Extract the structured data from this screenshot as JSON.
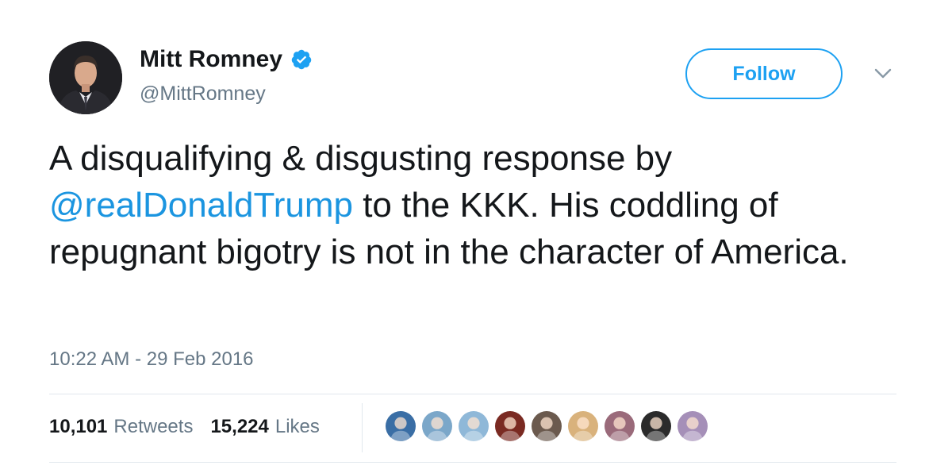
{
  "author": {
    "display_name": "Mitt Romney",
    "handle": "@MittRomney",
    "verified": true
  },
  "follow_label": "Follow",
  "tweet": {
    "text_before": "A disqualifying & disgusting response by ",
    "mention": "@realDonaldTrump",
    "text_after": " to the KKK. His coddling of repugnant bigotry is not in the character of America.",
    "timestamp": "10:22 AM - 29 Feb 2016"
  },
  "stats": {
    "retweets_count": "10,101",
    "retweets_label": "Retweets",
    "likes_count": "15,224",
    "likes_label": "Likes"
  },
  "colors": {
    "accent": "#1da1f2",
    "mention": "#1b95e0",
    "secondary_text": "#657786",
    "divider": "#e1e8ed"
  },
  "likers": [
    {
      "icon": "liker-avatar-icon",
      "color": "#3a6ea5"
    },
    {
      "icon": "liker-avatar-icon",
      "color": "#7ba7c9"
    },
    {
      "icon": "liker-avatar-icon",
      "color": "#8fb8d8"
    },
    {
      "icon": "liker-avatar-icon",
      "color": "#7a2a22"
    },
    {
      "icon": "liker-avatar-icon",
      "color": "#6b5a4e"
    },
    {
      "icon": "liker-avatar-icon",
      "color": "#d9b27c"
    },
    {
      "icon": "liker-avatar-icon",
      "color": "#9a6a7a"
    },
    {
      "icon": "liker-avatar-icon",
      "color": "#2b2b2b"
    },
    {
      "icon": "liker-avatar-icon",
      "color": "#a58fb8"
    }
  ]
}
